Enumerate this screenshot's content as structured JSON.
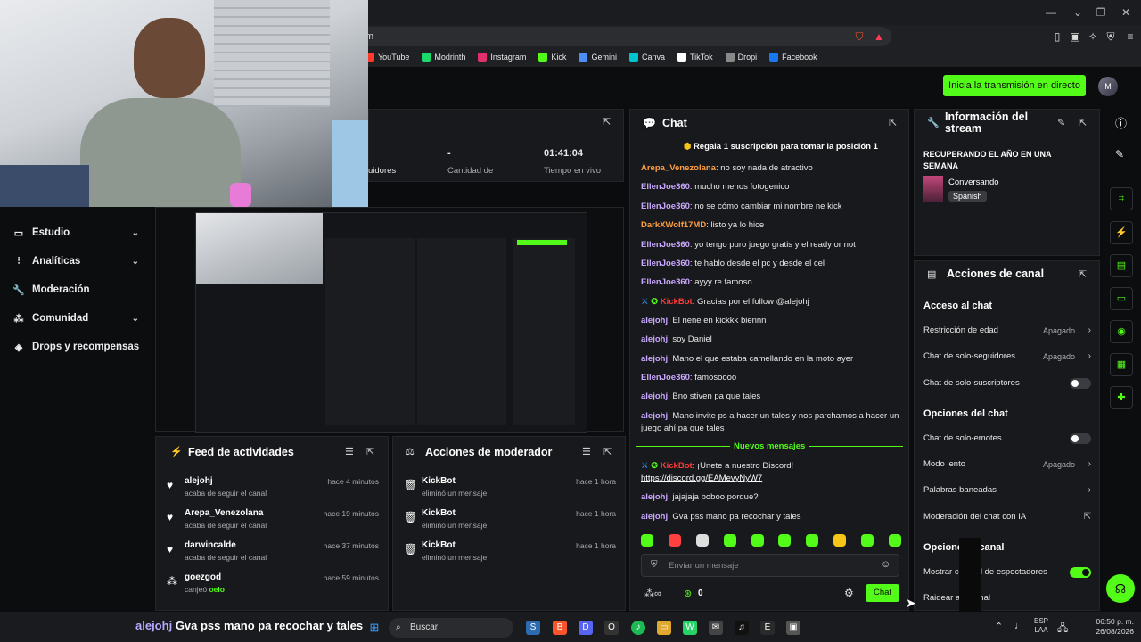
{
  "browser": {
    "url": "m",
    "bookmarks": [
      "YouTube",
      "Modrinth",
      "Instagram",
      "Kick",
      "Gemini",
      "Canva",
      "TikTok",
      "Dropi",
      "Facebook"
    ],
    "bookmark_colors": [
      "#ff3b30",
      "#1bd96a",
      "#e1306c",
      "#53fc18",
      "#4c8df6",
      "#00c4cc",
      "#ffffff",
      "#888888",
      "#1877f2"
    ]
  },
  "topbar": {
    "go_live_label": "Inicia la transmisión en directo",
    "avatar_initials": "M"
  },
  "sidebar": {
    "items": [
      {
        "label": "Estudio",
        "icon": "monitor-icon",
        "has_chevron": true
      },
      {
        "label": "Analíticas",
        "icon": "chart-icon",
        "has_chevron": true
      },
      {
        "label": "Moderación",
        "icon": "wrench-icon",
        "has_chevron": false
      },
      {
        "label": "Comunidad",
        "icon": "community-icon",
        "has_chevron": true
      },
      {
        "label": "Drops y recompensas",
        "icon": "drops-icon",
        "has_chevron": false
      }
    ]
  },
  "stats": {
    "followers_label": "uidores",
    "subs_value": "-",
    "subs_label": "Cantidad de",
    "live_time_value": "01:41:04",
    "live_time_label": "Tiempo en vivo"
  },
  "activity_feed": {
    "title": "Feed de actividades",
    "items": [
      {
        "name": "alejohj",
        "sub": "acaba de seguir el canal",
        "time": "hace 4 minutos",
        "icon": "heart-icon"
      },
      {
        "name": "Arepa_Venezolana",
        "sub": "acaba de seguir el canal",
        "time": "hace 19 minutos",
        "icon": "heart-icon"
      },
      {
        "name": "darwincalde",
        "sub": "acaba de seguir el canal",
        "time": "hace 37 minutos",
        "icon": "heart-icon"
      },
      {
        "name": "goezgod",
        "sub": "canjeó",
        "sub_highlight": "oelo",
        "time": "hace 59 minutos",
        "icon": "points-icon"
      }
    ]
  },
  "mod_actions": {
    "title": "Acciones de moderador",
    "items": [
      {
        "name": "KickBot",
        "sub": "eliminó un mensaje",
        "time": "hace 1 hora"
      },
      {
        "name": "KickBot",
        "sub": "eliminó un mensaje",
        "time": "hace 1 hora"
      },
      {
        "name": "KickBot",
        "sub": "eliminó un mensaje",
        "time": "hace 1 hora"
      }
    ]
  },
  "chat": {
    "title": "Chat",
    "pinned": "Regala 1 suscripción para tomar la posición 1",
    "messages": [
      {
        "user": "Arepa_Venezolana",
        "color": "#ff9f43",
        "text": "no soy nada de atractivo"
      },
      {
        "user": "EllenJoe360",
        "color": "#c9a8ff",
        "text": "mucho menos fotogenico"
      },
      {
        "user": "EllenJoe360",
        "color": "#c9a8ff",
        "text": "no se cómo cambiar mi nombre ne kick"
      },
      {
        "user": "DarkXWolf17MD",
        "color": "#ff9f43",
        "text": "listo ya lo hice"
      },
      {
        "user": "EllenJoe360",
        "color": "#c9a8ff",
        "text": "yo tengo puro juego gratis y el ready or not"
      },
      {
        "user": "EllenJoe360",
        "color": "#c9a8ff",
        "text": "te hablo desde el pc y desde el cel"
      },
      {
        "user": "EllenJoe360",
        "color": "#c9a8ff",
        "text": "ayyy re famoso"
      },
      {
        "user": "KickBot",
        "color": "#ff3b3b",
        "text": "Gracias por el follow @alejohj",
        "badges": true
      },
      {
        "user": "alejohj",
        "color": "#c9a8ff",
        "text": "El nene en kickkk biennn"
      },
      {
        "user": "alejohj",
        "color": "#c9a8ff",
        "text": "soy Daniel"
      },
      {
        "user": "alejohj",
        "color": "#c9a8ff",
        "text": "Mano el que estaba camellando en la moto ayer"
      },
      {
        "user": "EllenJoe360",
        "color": "#c9a8ff",
        "text": "famosoooo"
      },
      {
        "user": "alejohj",
        "color": "#c9a8ff",
        "text": "Bno stiven pa que tales"
      },
      {
        "user": "alejohj",
        "color": "#c9a8ff",
        "text": "Mano invite ps a hacer un tales y nos parchamos a hacer un juego ahí pa que tales"
      }
    ],
    "new_messages_label": "Nuevos mensajes",
    "new_messages": [
      {
        "user": "KickBot",
        "color": "#ff3b3b",
        "text": "¡Unete a nuestro Discord!",
        "link": "https://discord.gg/EAMevyNyW7",
        "badges": true
      },
      {
        "user": "alejohj",
        "color": "#c9a8ff",
        "text": "jajajaja boboo porque?"
      },
      {
        "user": "alejohj",
        "color": "#c9a8ff",
        "text": "Gva pss mano pa recochar y tales"
      }
    ],
    "input_placeholder": "Enviar un mensaje",
    "points_value": "0",
    "send_label": "Chat"
  },
  "stream_info": {
    "title": "Información del stream",
    "stream_title": "RECUPERANDO EL AÑO EN UNA SEMANA",
    "category": "Conversando",
    "language": "Spanish"
  },
  "channel_actions": {
    "title": "Acciones de canal",
    "chat_access_title": "Acceso al chat",
    "age_label": "Restricción de edad",
    "age_value": "Apagado",
    "followers_only_label": "Chat de solo-seguidores",
    "followers_only_value": "Apagado",
    "subs_only_label": "Chat de solo-suscriptores",
    "chat_options_title": "Opciones del chat",
    "emotes_only_label": "Chat de solo-emotes",
    "slow_mode_label": "Modo lento",
    "slow_mode_value": "Apagado",
    "banned_words_label": "Palabras baneadas",
    "ai_mod_label": "Moderación del chat con IA",
    "channel_options_title": "Opcione    l canal",
    "show_viewers_label": "Mostrar c      ad de espectadores",
    "raid_label": "Raidear a      anal"
  },
  "overlay": {
    "user": "alejohj",
    "text": "Gva pss mano pa recochar y tales"
  },
  "taskbar": {
    "search_label": "Buscar",
    "lang_top": "ESP",
    "lang_bottom": "LAA",
    "time": "06:50 p. m.",
    "date": "26/08/2026"
  }
}
